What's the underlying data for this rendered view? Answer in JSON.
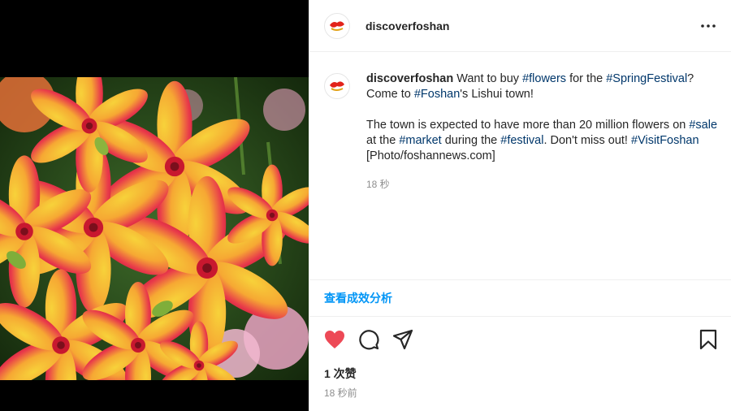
{
  "post": {
    "username": "discoverfoshan",
    "avatar_icon": "discoverfoshan-logo",
    "more_icon": "more-options-icon"
  },
  "caption": {
    "username": "discoverfoshan",
    "line1_a": " Want to buy ",
    "tag_flowers": "#flowers",
    "line1_b": " for the ",
    "tag_spring": "#SpringFestival",
    "line1_c": "?",
    "line2_a": "Come to ",
    "tag_foshan": "#Foshan",
    "line2_b": "'s Lishui town!",
    "line3_a": "The town is expected to have more than 20 million flowers on ",
    "tag_sale": "#sale",
    "line4_a": "at the ",
    "tag_market": "#market",
    "line4_b": " during the ",
    "tag_festival": "#festival",
    "line4_c": ". Don't miss out! ",
    "tag_visit": "#VisitFoshan",
    "line5": "[Photo/foshannews.com]",
    "time": "18 秒"
  },
  "insights_label": "查看成效分析",
  "actions": {
    "like_color": "#ed4956",
    "icons": [
      "heart-icon",
      "comment-icon",
      "share-icon",
      "bookmark-icon"
    ]
  },
  "likes": "1 次赞",
  "posted_time": "18 秒前",
  "colors": {
    "link": "#00376b",
    "accent": "#0095f6",
    "muted": "#8e8e8e"
  }
}
